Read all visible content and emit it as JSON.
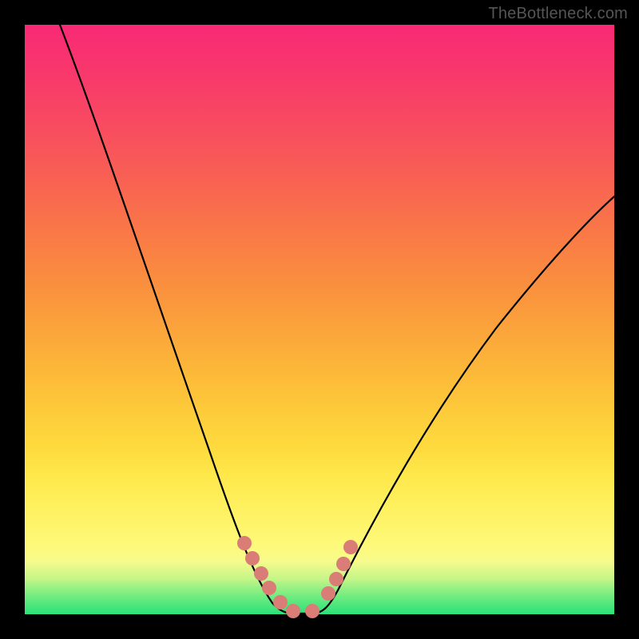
{
  "watermark": "TheBottleneck.com",
  "colors": {
    "page_bg": "#000000",
    "dot": "#d97d76",
    "curve": "#000000"
  },
  "chart_data": {
    "type": "line",
    "title": "",
    "xlabel": "",
    "ylabel": "",
    "xlim": [
      0,
      100
    ],
    "ylim": [
      0,
      100
    ],
    "grid": false,
    "legend": false,
    "axes_visible": false,
    "note": "Values estimated from pixels; y = height within gradient panel (0 bottom, 100 top).",
    "series": [
      {
        "name": "bottleneck-curve",
        "x": [
          6,
          10,
          14,
          18,
          22,
          26,
          30,
          34,
          37,
          40,
          42,
          44,
          47,
          50,
          53,
          57,
          62,
          68,
          74,
          80,
          86,
          92,
          100
        ],
        "y": [
          100,
          87,
          74,
          62,
          50,
          40,
          30,
          20,
          12,
          6,
          2,
          0,
          0,
          2,
          8,
          16,
          27,
          38,
          47,
          55,
          61,
          66,
          71
        ]
      }
    ],
    "highlight_points": {
      "name": "highlight-dots",
      "x": [
        37.3,
        38.6,
        40.1,
        41.5,
        43.3,
        45.5,
        48.8,
        51.5,
        52.8,
        54.0,
        55.2
      ],
      "y": [
        12.0,
        9.4,
        6.9,
        4.5,
        2.0,
        0.6,
        0.6,
        3.5,
        6.0,
        8.6,
        11.4
      ]
    }
  }
}
